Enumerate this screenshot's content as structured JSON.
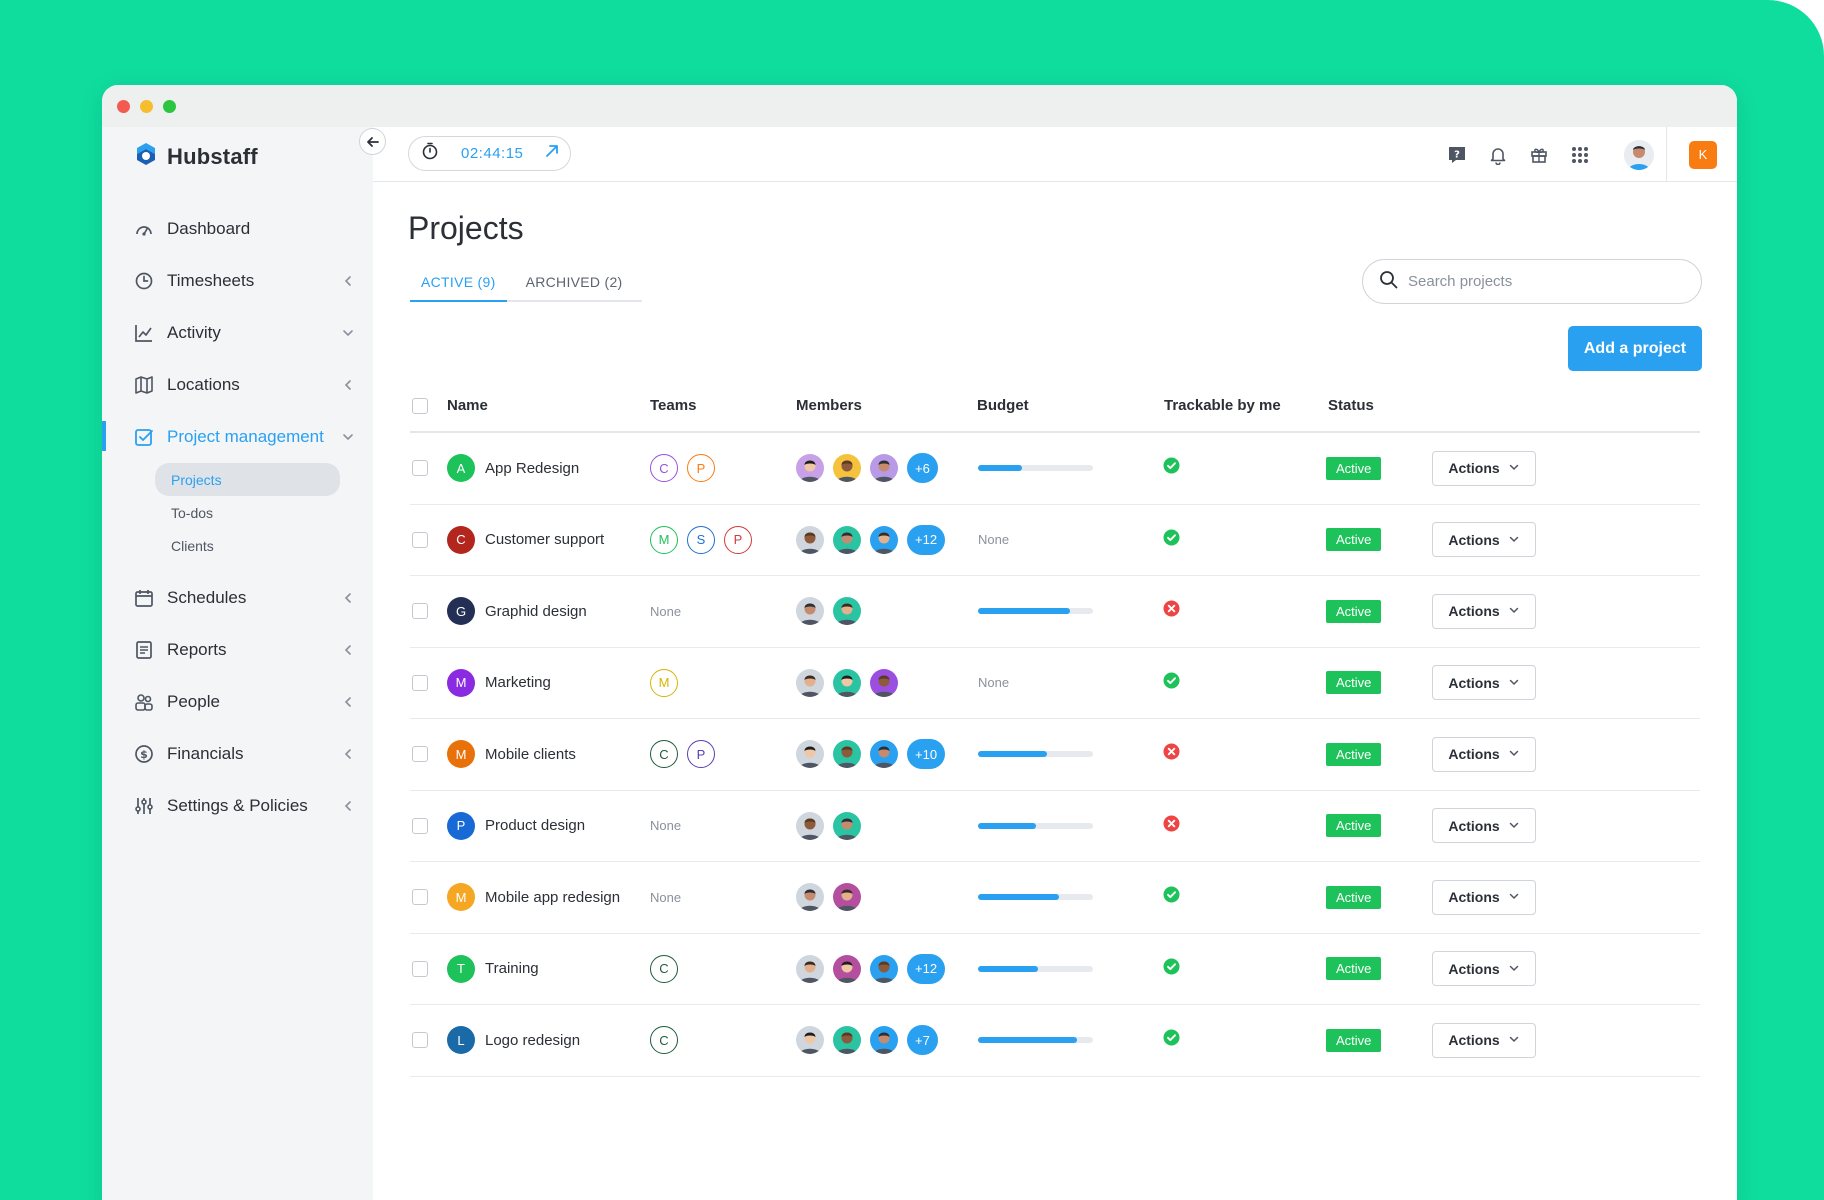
{
  "app": {
    "name": "Hubstaff"
  },
  "timer": {
    "value": "02:44:15"
  },
  "user": {
    "org_initial": "K"
  },
  "sidebar": {
    "items": [
      {
        "label": "Dashboard",
        "icon": "dashboard-icon",
        "chevron": "none"
      },
      {
        "label": "Timesheets",
        "icon": "clock-icon",
        "chevron": "left"
      },
      {
        "label": "Activity",
        "icon": "activity-icon",
        "chevron": "down"
      },
      {
        "label": "Locations",
        "icon": "map-icon",
        "chevron": "left"
      },
      {
        "label": "Project management",
        "icon": "checkbox-icon",
        "chevron": "down",
        "active": true
      },
      {
        "label": "Schedules",
        "icon": "calendar-icon",
        "chevron": "left"
      },
      {
        "label": "Reports",
        "icon": "report-icon",
        "chevron": "left"
      },
      {
        "label": "People",
        "icon": "people-icon",
        "chevron": "left"
      },
      {
        "label": "Financials",
        "icon": "dollar-icon",
        "chevron": "left"
      },
      {
        "label": "Settings & Policies",
        "icon": "sliders-icon",
        "chevron": "left"
      }
    ],
    "subitems": [
      {
        "label": "Projects",
        "selected": true
      },
      {
        "label": "To-dos"
      },
      {
        "label": "Clients"
      }
    ]
  },
  "page": {
    "title": "Projects",
    "tabs": [
      {
        "label": "ACTIVE (9)",
        "active": true
      },
      {
        "label": "ARCHIVED (2)"
      }
    ],
    "search_placeholder": "Search projects",
    "add_button": "Add a project"
  },
  "table": {
    "columns": {
      "name": "Name",
      "teams": "Teams",
      "members": "Members",
      "budget": "Budget",
      "trackable": "Trackable by me",
      "status": "Status"
    },
    "actions_label": "Actions",
    "none_label": "None",
    "rows": [
      {
        "initial": "A",
        "color": "#1ec25a",
        "name": "App Redesign",
        "teams": [
          {
            "l": "C",
            "c": "#9b4fe0"
          },
          {
            "l": "P",
            "c": "#f97c12"
          }
        ],
        "members": [
          "#c7a0e8",
          "#f5c23e",
          "#b89ae6"
        ],
        "more": "+6",
        "budget": 0.38,
        "trackable": true,
        "status": "Active"
      },
      {
        "initial": "C",
        "color": "#b3261e",
        "name": "Customer support",
        "teams": [
          {
            "l": "M",
            "c": "#1ec25a"
          },
          {
            "l": "S",
            "c": "#1f6fd1"
          },
          {
            "l": "P",
            "c": "#d13b3b"
          }
        ],
        "members": [
          "#cfd6de",
          "#2bc4a3",
          "#2aa0f0"
        ],
        "more": "+12",
        "budget": null,
        "trackable": true,
        "status": "Active"
      },
      {
        "initial": "G",
        "color": "#232f55",
        "name": "Graphid design",
        "teams": [],
        "members": [
          "#cfd6de",
          "#2bc4a3"
        ],
        "more": "",
        "budget": 0.8,
        "trackable": false,
        "status": "Active"
      },
      {
        "initial": "M",
        "color": "#8a2be2",
        "name": "Marketing",
        "teams": [
          {
            "l": "M",
            "c": "#d6b400"
          }
        ],
        "members": [
          "#cfd6de",
          "#2bc4a3",
          "#9b4fe0"
        ],
        "more": "",
        "budget": null,
        "trackable": true,
        "status": "Active"
      },
      {
        "initial": "M",
        "color": "#e8710a",
        "name": "Mobile clients",
        "teams": [
          {
            "l": "C",
            "c": "#1f5c3c"
          },
          {
            "l": "P",
            "c": "#5a3fb3"
          }
        ],
        "members": [
          "#cfd6de",
          "#2bc4a3",
          "#2aa0f0"
        ],
        "more": "+10",
        "budget": 0.6,
        "trackable": false,
        "status": "Active"
      },
      {
        "initial": "P",
        "color": "#1769d6",
        "name": "Product design",
        "teams": [],
        "members": [
          "#cfd6de",
          "#2bc4a3"
        ],
        "more": "",
        "budget": 0.5,
        "trackable": false,
        "status": "Active"
      },
      {
        "initial": "M",
        "color": "#f5a623",
        "name": "Mobile app redesign",
        "teams": [],
        "members": [
          "#cfd6de",
          "#b44fa0"
        ],
        "more": "",
        "budget": 0.7,
        "trackable": true,
        "status": "Active"
      },
      {
        "initial": "T",
        "color": "#1ec25a",
        "name": "Training",
        "teams": [
          {
            "l": "C",
            "c": "#1f5c3c"
          }
        ],
        "members": [
          "#cfd6de",
          "#b44fa0",
          "#2aa0f0"
        ],
        "more": "+12",
        "budget": 0.52,
        "trackable": true,
        "status": "Active"
      },
      {
        "initial": "L",
        "color": "#1a6aa8",
        "name": "Logo redesign",
        "teams": [
          {
            "l": "C",
            "c": "#1f5c3c"
          }
        ],
        "members": [
          "#cfd6de",
          "#2bc4a3",
          "#2aa0f0"
        ],
        "more": "+7",
        "budget": 0.86,
        "trackable": true,
        "status": "Active"
      }
    ]
  }
}
